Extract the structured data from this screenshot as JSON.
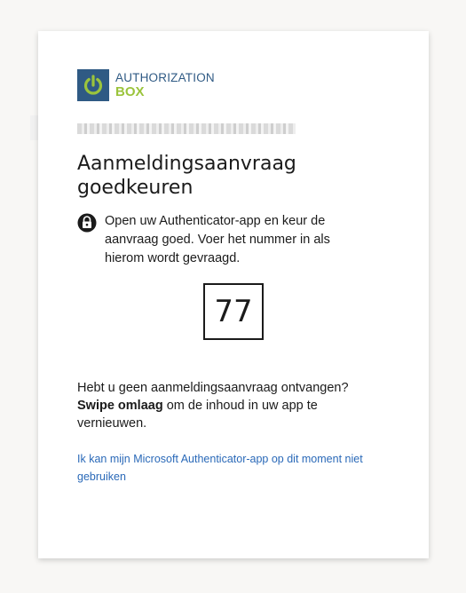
{
  "logo": {
    "line1": "AUTHORIZATION",
    "line2": "BOX",
    "icon": "power-icon",
    "colors": {
      "square": "#2f5a84",
      "power": "#9bc43c",
      "text_top": "#2f5a84",
      "text_bottom": "#9bc43c"
    }
  },
  "account": {
    "redacted_icon": "redacted-account-email"
  },
  "title": "Aanmeldingsaanvraag goedkeuren",
  "instruction": {
    "icon": "lock-icon",
    "text": "Open uw Authenticator-app en keur de aanvraag goed. Voer het nummer in als hierom wordt gevraagd."
  },
  "number": "77",
  "info": {
    "line1": "Hebt u geen aanmeldingsaanvraag ontvangen?",
    "bold": "Swipe omlaag",
    "rest": " om de inhoud in uw app te vernieuwen."
  },
  "link": "Ik kan mijn Microsoft Authenticator-app op dit moment niet gebruiken",
  "colors": {
    "background": "#f8f7f5",
    "card": "#ffffff",
    "text": "#1b1b1b",
    "link": "#2a69b8"
  }
}
